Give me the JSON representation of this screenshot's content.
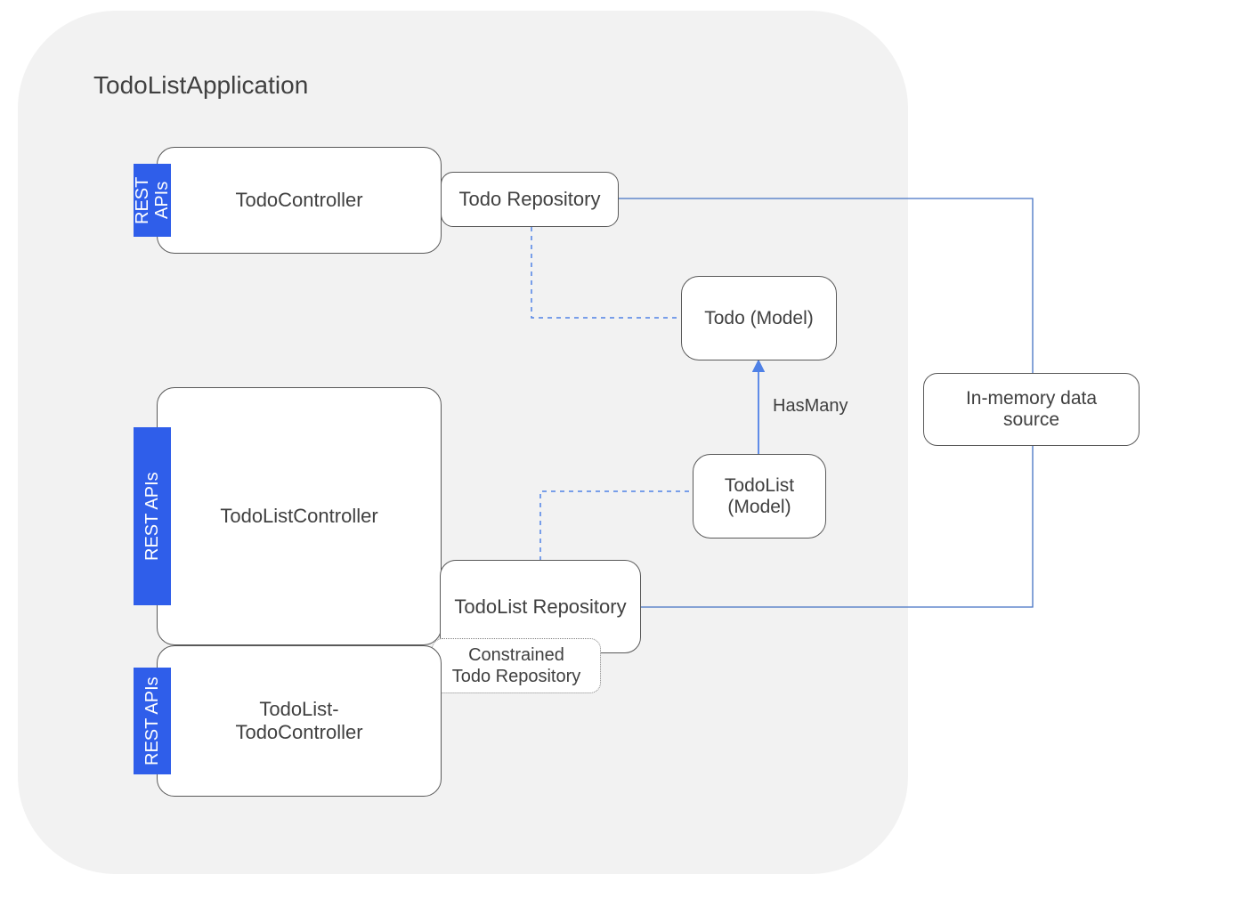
{
  "app": {
    "title": "TodoListApplication"
  },
  "badges": {
    "rest1": "REST\nAPIs",
    "rest2": "REST APIs",
    "rest3": "REST APIs"
  },
  "boxes": {
    "todoController": "TodoController",
    "todoRepository": "Todo Repository",
    "todoModel": "Todo (Model)",
    "todoListController": "TodoListController",
    "todoListRepository": "TodoList Repository",
    "constrainedTodoRepo": "Constrained\nTodo Repository",
    "todoListTodoController": "TodoList-\nTodoController",
    "todoListModel": "TodoList\n(Model)",
    "dataSource": "In-memory data\nsource"
  },
  "edges": {
    "hasMany": "HasMany"
  },
  "colors": {
    "bg": "#f2f2f2",
    "boxBorder": "#595959",
    "badge": "#2f5eea",
    "solidLine": "#4472c4",
    "dashedLine": "#4472c4"
  }
}
